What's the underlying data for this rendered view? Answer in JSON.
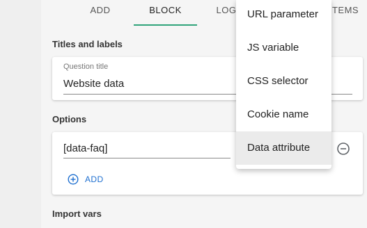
{
  "tabs": [
    {
      "label": "ADD"
    },
    {
      "label": "BLOCK"
    },
    {
      "label": "LOGIC"
    },
    {
      "label": "ITEMS"
    }
  ],
  "active_tab": "BLOCK",
  "accent_color": "#2fa37a",
  "link_color": "#1e6fd0",
  "titles": {
    "section_label": "Titles and labels",
    "question_title_caption": "Question title",
    "question_title_value": "Website data"
  },
  "options": {
    "section_label": "Options",
    "value": "[data-faq]",
    "add_label": "ADD"
  },
  "import_vars": {
    "section_label": "Import vars"
  },
  "menu": {
    "items": [
      {
        "label": "URL parameter"
      },
      {
        "label": "JS variable"
      },
      {
        "label": "CSS selector"
      },
      {
        "label": "Cookie name"
      },
      {
        "label": "Data attribute"
      }
    ],
    "highlighted": "Data attribute"
  },
  "icons": {
    "add": "add-circle-icon",
    "remove": "remove-circle-icon"
  }
}
